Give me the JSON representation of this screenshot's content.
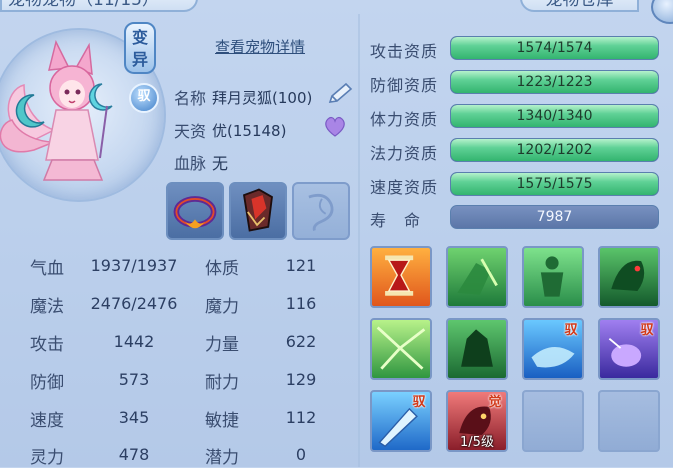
{
  "header": {
    "left_tab": "宠物宠物（11/15）",
    "right_tab": "宠物仓库"
  },
  "pet": {
    "variant_badge": "变异",
    "bound_badge": "驭",
    "detail_link": "查看宠物详情",
    "name_label": "名称",
    "name_value": "拜月灵狐(100)",
    "talent_label": "天资",
    "talent_value": "优(15148)",
    "bloodline_label": "血脉",
    "bloodline_value": "无"
  },
  "stats": [
    {
      "label": "气血",
      "value": "1937/1937",
      "label2": "体质",
      "value2": "121"
    },
    {
      "label": "魔法",
      "value": "2476/2476",
      "label2": "魔力",
      "value2": "116"
    },
    {
      "label": "攻击",
      "value": "1442",
      "label2": "力量",
      "value2": "622"
    },
    {
      "label": "防御",
      "value": "573",
      "label2": "耐力",
      "value2": "129"
    },
    {
      "label": "速度",
      "value": "345",
      "label2": "敏捷",
      "value2": "112"
    },
    {
      "label": "灵力",
      "value": "478",
      "label2": "潜力",
      "value2": "0"
    }
  ],
  "aptitudes": [
    {
      "label": "攻击资质",
      "text": "1574/1574",
      "fill": 1.0
    },
    {
      "label": "防御资质",
      "text": "1223/1223",
      "fill": 1.0
    },
    {
      "label": "体力资质",
      "text": "1340/1340",
      "fill": 1.0
    },
    {
      "label": "法力资质",
      "text": "1202/1202",
      "fill": 1.0
    },
    {
      "label": "速度资质",
      "text": "1575/1575",
      "fill": 1.0
    }
  ],
  "life": {
    "label": "寿　命",
    "value": "7987"
  },
  "skills": {
    "tag_yu": "驭",
    "tag_jue": "觉",
    "awaken_level": "1/5级"
  },
  "colors": {
    "accent_green": "#33b46f",
    "tag_red": "#d23a1a"
  }
}
